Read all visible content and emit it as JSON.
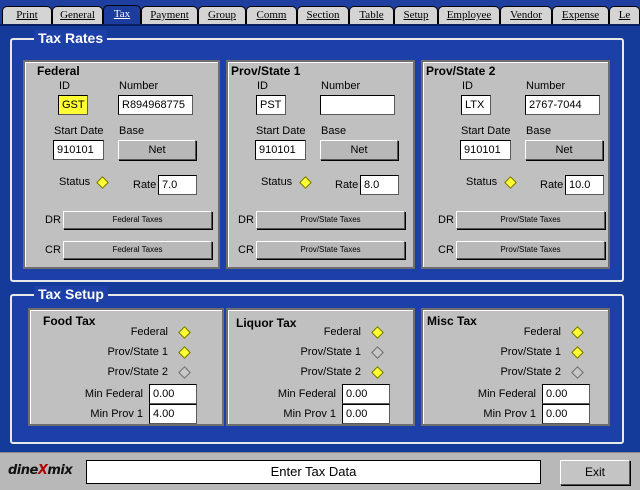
{
  "tabs": [
    {
      "label": "Print",
      "active": false
    },
    {
      "label": "General",
      "active": false
    },
    {
      "label": "Tax",
      "active": true
    },
    {
      "label": "Payment",
      "active": false
    },
    {
      "label": "Group",
      "active": false
    },
    {
      "label": "Comm",
      "active": false
    },
    {
      "label": "Section",
      "active": false
    },
    {
      "label": "Table",
      "active": false
    },
    {
      "label": "Setup",
      "active": false
    },
    {
      "label": "Employee",
      "active": false
    },
    {
      "label": "Vendor",
      "active": false
    },
    {
      "label": "Expense",
      "active": false
    },
    {
      "label": "Le",
      "active": false
    }
  ],
  "tax_rates": {
    "title": "Tax Rates",
    "labels": {
      "id": "ID",
      "number": "Number",
      "start_date": "Start Date",
      "base": "Base",
      "status": "Status",
      "rate": "Rate",
      "dr": "DR",
      "cr": "CR"
    },
    "panels": [
      {
        "title": "Federal",
        "id": "GST",
        "number": "R894968775",
        "start_date": "910101",
        "base": "Net",
        "status_on": true,
        "rate": "7.0",
        "dr": "Federal Taxes",
        "cr": "Federal Taxes"
      },
      {
        "title": "Prov/State 1",
        "id": "PST",
        "number": "",
        "start_date": "910101",
        "base": "Net",
        "status_on": true,
        "rate": "8.0",
        "dr": "Prov/State Taxes",
        "cr": "Prov/State Taxes"
      },
      {
        "title": "Prov/State 2",
        "id": "LTX",
        "number": "2767-7044",
        "start_date": "910101",
        "base": "Net",
        "status_on": true,
        "rate": "10.0",
        "dr": "Prov/State Taxes",
        "cr": "Prov/State Taxes"
      }
    ]
  },
  "tax_setup": {
    "title": "Tax Setup",
    "labels": {
      "federal": "Federal",
      "prov1": "Prov/State 1",
      "prov2": "Prov/State 2",
      "min_federal": "Min Federal",
      "min_prov1": "Min Prov 1"
    },
    "panels": [
      {
        "title": "Food Tax",
        "federal_on": true,
        "prov1_on": true,
        "prov2_on": false,
        "min_federal": "0.00",
        "min_prov1": "4.00"
      },
      {
        "title": "Liquor Tax",
        "federal_on": true,
        "prov1_on": false,
        "prov2_on": true,
        "min_federal": "0.00",
        "min_prov1": "0.00"
      },
      {
        "title": "Misc Tax",
        "federal_on": true,
        "prov1_on": true,
        "prov2_on": false,
        "min_federal": "0.00",
        "min_prov1": "0.00"
      }
    ]
  },
  "footer": {
    "logo_left": "dine",
    "logo_mid": "X",
    "logo_right": "mix",
    "status": "Enter Tax Data",
    "exit_label": "Exit"
  },
  "colors": {
    "window_bg": "#143a9a",
    "highlight": "#ffff33",
    "panel_bg": "#c0c0c0"
  }
}
